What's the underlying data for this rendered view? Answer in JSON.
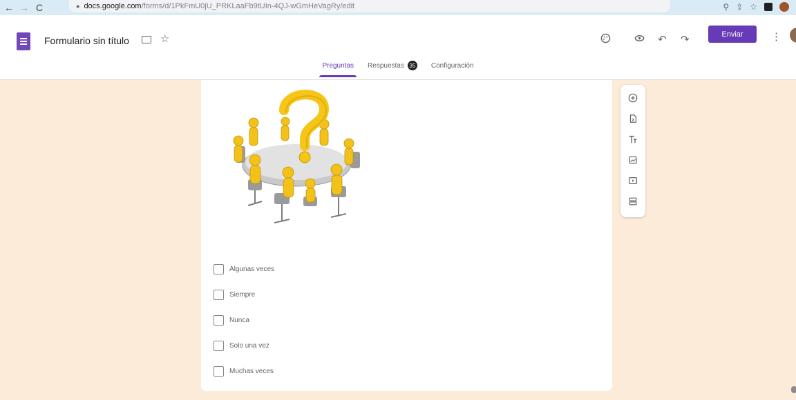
{
  "browser": {
    "url_host": "docs.google.com",
    "url_path": "/forms/d/1PkFmU0jU_PRKLaaFb9tUIn-4QJ-wGmHeVagRy/edit",
    "back_glyph": "←",
    "forward_glyph": "→",
    "reload_glyph": "C"
  },
  "header": {
    "title": "Formulario sin título",
    "send_label": "Enviar",
    "colors": {
      "accent": "#673ab7",
      "background": "#fdebd9"
    }
  },
  "tabs": [
    {
      "label": "Preguntas",
      "active": true
    },
    {
      "label": "Respuestas",
      "count": "35",
      "active": false
    },
    {
      "label": "Configuración",
      "active": false
    }
  ],
  "question": {
    "options": [
      {
        "label": "Algunas veces"
      },
      {
        "label": "Siempre"
      },
      {
        "label": "Nunca"
      },
      {
        "label": "Solo una vez"
      },
      {
        "label": "Muchas veces"
      }
    ]
  },
  "toolbar": {
    "icons": [
      "add-question-icon",
      "import-questions-icon",
      "add-title-icon",
      "add-image-icon",
      "add-video-icon",
      "add-section-icon"
    ]
  }
}
